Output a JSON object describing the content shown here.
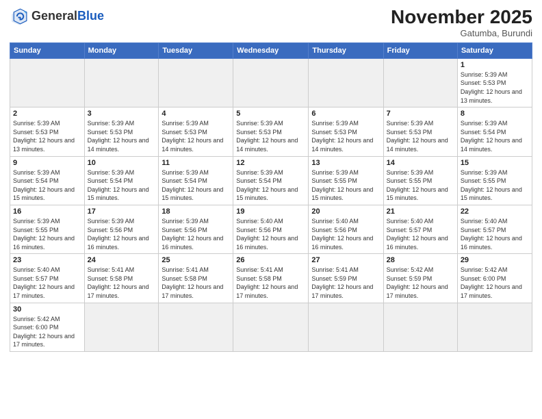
{
  "logo": {
    "general": "General",
    "blue": "Blue"
  },
  "header": {
    "month": "November 2025",
    "location": "Gatumba, Burundi"
  },
  "weekdays": [
    "Sunday",
    "Monday",
    "Tuesday",
    "Wednesday",
    "Thursday",
    "Friday",
    "Saturday"
  ],
  "weeks": [
    [
      {
        "day": "",
        "info": "",
        "empty": true
      },
      {
        "day": "",
        "info": "",
        "empty": true
      },
      {
        "day": "",
        "info": "",
        "empty": true
      },
      {
        "day": "",
        "info": "",
        "empty": true
      },
      {
        "day": "",
        "info": "",
        "empty": true
      },
      {
        "day": "",
        "info": "",
        "empty": true
      },
      {
        "day": "1",
        "info": "Sunrise: 5:39 AM\nSunset: 5:53 PM\nDaylight: 12 hours\nand 13 minutes."
      }
    ],
    [
      {
        "day": "2",
        "info": "Sunrise: 5:39 AM\nSunset: 5:53 PM\nDaylight: 12 hours\nand 13 minutes."
      },
      {
        "day": "3",
        "info": "Sunrise: 5:39 AM\nSunset: 5:53 PM\nDaylight: 12 hours\nand 14 minutes."
      },
      {
        "day": "4",
        "info": "Sunrise: 5:39 AM\nSunset: 5:53 PM\nDaylight: 12 hours\nand 14 minutes."
      },
      {
        "day": "5",
        "info": "Sunrise: 5:39 AM\nSunset: 5:53 PM\nDaylight: 12 hours\nand 14 minutes."
      },
      {
        "day": "6",
        "info": "Sunrise: 5:39 AM\nSunset: 5:53 PM\nDaylight: 12 hours\nand 14 minutes."
      },
      {
        "day": "7",
        "info": "Sunrise: 5:39 AM\nSunset: 5:53 PM\nDaylight: 12 hours\nand 14 minutes."
      },
      {
        "day": "8",
        "info": "Sunrise: 5:39 AM\nSunset: 5:54 PM\nDaylight: 12 hours\nand 14 minutes."
      }
    ],
    [
      {
        "day": "9",
        "info": "Sunrise: 5:39 AM\nSunset: 5:54 PM\nDaylight: 12 hours\nand 15 minutes."
      },
      {
        "day": "10",
        "info": "Sunrise: 5:39 AM\nSunset: 5:54 PM\nDaylight: 12 hours\nand 15 minutes."
      },
      {
        "day": "11",
        "info": "Sunrise: 5:39 AM\nSunset: 5:54 PM\nDaylight: 12 hours\nand 15 minutes."
      },
      {
        "day": "12",
        "info": "Sunrise: 5:39 AM\nSunset: 5:54 PM\nDaylight: 12 hours\nand 15 minutes."
      },
      {
        "day": "13",
        "info": "Sunrise: 5:39 AM\nSunset: 5:55 PM\nDaylight: 12 hours\nand 15 minutes."
      },
      {
        "day": "14",
        "info": "Sunrise: 5:39 AM\nSunset: 5:55 PM\nDaylight: 12 hours\nand 15 minutes."
      },
      {
        "day": "15",
        "info": "Sunrise: 5:39 AM\nSunset: 5:55 PM\nDaylight: 12 hours\nand 15 minutes."
      }
    ],
    [
      {
        "day": "16",
        "info": "Sunrise: 5:39 AM\nSunset: 5:55 PM\nDaylight: 12 hours\nand 16 minutes."
      },
      {
        "day": "17",
        "info": "Sunrise: 5:39 AM\nSunset: 5:56 PM\nDaylight: 12 hours\nand 16 minutes."
      },
      {
        "day": "18",
        "info": "Sunrise: 5:39 AM\nSunset: 5:56 PM\nDaylight: 12 hours\nand 16 minutes."
      },
      {
        "day": "19",
        "info": "Sunrise: 5:40 AM\nSunset: 5:56 PM\nDaylight: 12 hours\nand 16 minutes."
      },
      {
        "day": "20",
        "info": "Sunrise: 5:40 AM\nSunset: 5:56 PM\nDaylight: 12 hours\nand 16 minutes."
      },
      {
        "day": "21",
        "info": "Sunrise: 5:40 AM\nSunset: 5:57 PM\nDaylight: 12 hours\nand 16 minutes."
      },
      {
        "day": "22",
        "info": "Sunrise: 5:40 AM\nSunset: 5:57 PM\nDaylight: 12 hours\nand 16 minutes."
      }
    ],
    [
      {
        "day": "23",
        "info": "Sunrise: 5:40 AM\nSunset: 5:57 PM\nDaylight: 12 hours\nand 17 minutes."
      },
      {
        "day": "24",
        "info": "Sunrise: 5:41 AM\nSunset: 5:58 PM\nDaylight: 12 hours\nand 17 minutes."
      },
      {
        "day": "25",
        "info": "Sunrise: 5:41 AM\nSunset: 5:58 PM\nDaylight: 12 hours\nand 17 minutes."
      },
      {
        "day": "26",
        "info": "Sunrise: 5:41 AM\nSunset: 5:58 PM\nDaylight: 12 hours\nand 17 minutes."
      },
      {
        "day": "27",
        "info": "Sunrise: 5:41 AM\nSunset: 5:59 PM\nDaylight: 12 hours\nand 17 minutes."
      },
      {
        "day": "28",
        "info": "Sunrise: 5:42 AM\nSunset: 5:59 PM\nDaylight: 12 hours\nand 17 minutes."
      },
      {
        "day": "29",
        "info": "Sunrise: 5:42 AM\nSunset: 6:00 PM\nDaylight: 12 hours\nand 17 minutes."
      }
    ],
    [
      {
        "day": "30",
        "info": "Sunrise: 5:42 AM\nSunset: 6:00 PM\nDaylight: 12 hours\nand 17 minutes."
      },
      {
        "day": "",
        "info": "",
        "empty": true
      },
      {
        "day": "",
        "info": "",
        "empty": true
      },
      {
        "day": "",
        "info": "",
        "empty": true
      },
      {
        "day": "",
        "info": "",
        "empty": true
      },
      {
        "day": "",
        "info": "",
        "empty": true
      },
      {
        "day": "",
        "info": "",
        "empty": true
      }
    ]
  ]
}
